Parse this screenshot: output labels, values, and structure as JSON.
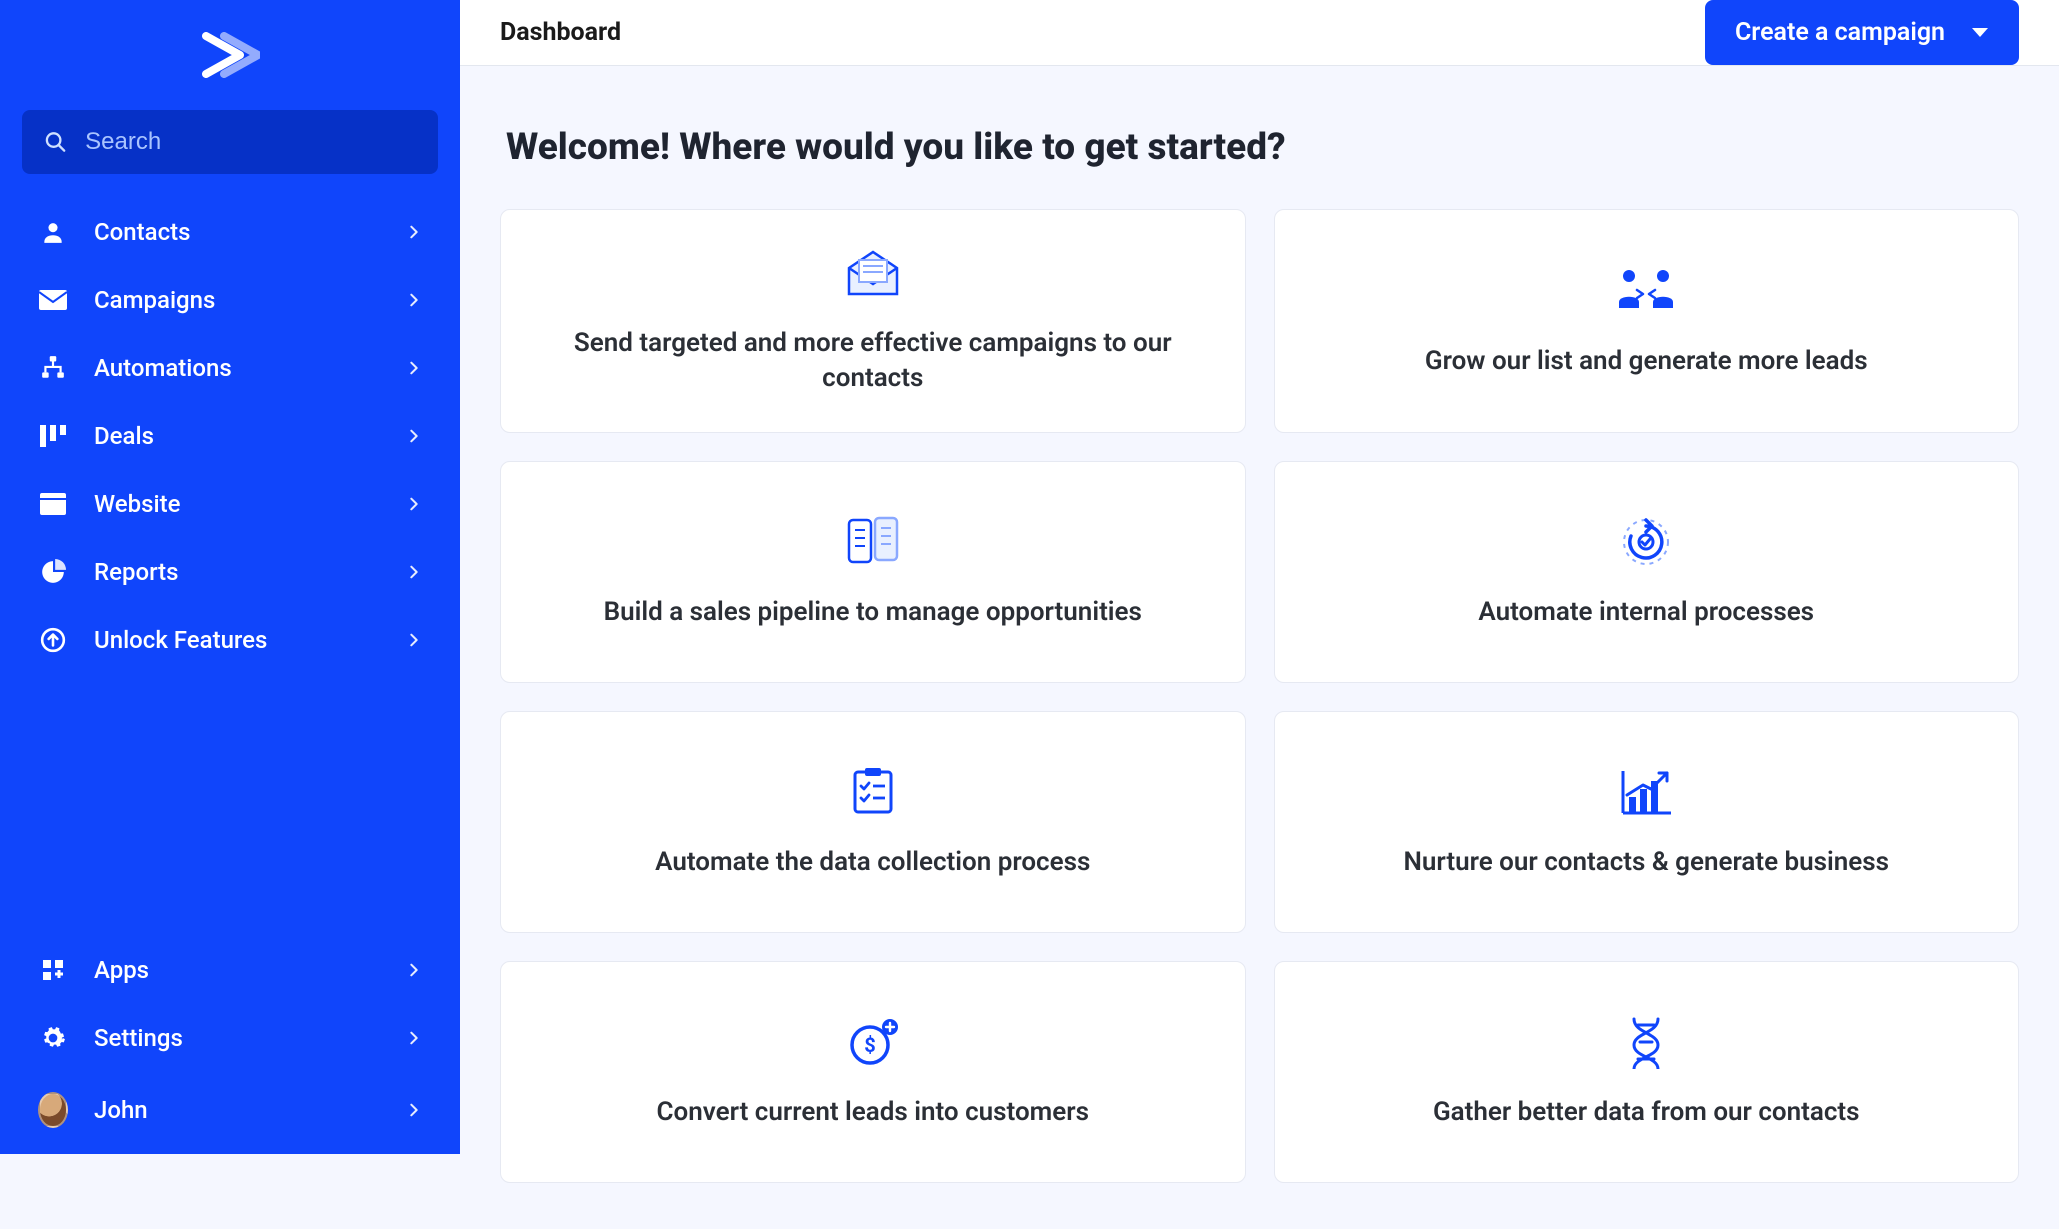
{
  "brand": {
    "accent": "#1045fb"
  },
  "sidebar": {
    "search_placeholder": "Search",
    "items": [
      {
        "label": "Contacts",
        "icon": "person"
      },
      {
        "label": "Campaigns",
        "icon": "envelope"
      },
      {
        "label": "Automations",
        "icon": "automation"
      },
      {
        "label": "Deals",
        "icon": "columns"
      },
      {
        "label": "Website",
        "icon": "window"
      },
      {
        "label": "Reports",
        "icon": "piechart"
      },
      {
        "label": "Unlock Features",
        "icon": "unlock"
      }
    ],
    "footer_items": [
      {
        "label": "Apps",
        "icon": "apps"
      },
      {
        "label": "Settings",
        "icon": "gear"
      }
    ],
    "user": {
      "name": "John"
    }
  },
  "topbar": {
    "title": "Dashboard",
    "cta_label": "Create a campaign"
  },
  "main": {
    "welcome": "Welcome! Where would you like to get started?",
    "cards": [
      {
        "text": "Send targeted and more effective campaigns to our contacts",
        "icon": "mail-open"
      },
      {
        "text": "Grow our list and generate more leads",
        "icon": "people-sync"
      },
      {
        "text": "Build a sales pipeline to manage opportunities",
        "icon": "two-docs"
      },
      {
        "text": "Automate internal processes",
        "icon": "process-cycle"
      },
      {
        "text": "Automate the data collection process",
        "icon": "checklist"
      },
      {
        "text": "Nurture our contacts & generate business",
        "icon": "growth-chart"
      },
      {
        "text": "Convert current leads into customers",
        "icon": "dollar-convert"
      },
      {
        "text": "Gather better data from our contacts",
        "icon": "dna"
      }
    ]
  }
}
